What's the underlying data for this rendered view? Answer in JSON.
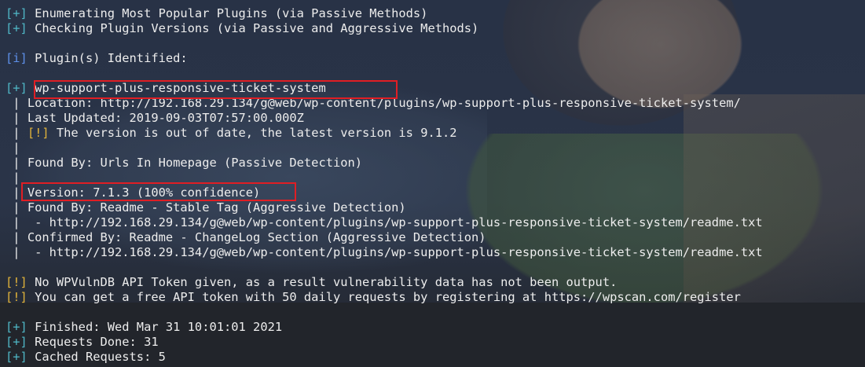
{
  "terminal": {
    "lines": {
      "enum_plugins": {
        "prefix": "[+]",
        "text": " Enumerating Most Popular Plugins (via Passive Methods)"
      },
      "check_versions": {
        "prefix": "[+]",
        "text": " Checking Plugin Versions (via Passive and Aggressive Methods)"
      },
      "identified": {
        "prefix": "[i]",
        "text": " Plugin(s) Identified:"
      },
      "plugin_name": {
        "prefix": "[+]",
        "text": " wp-support-plus-responsive-ticket-system"
      },
      "location": {
        "pipe": " | ",
        "text": "Location: http://192.168.29.134/g@web/wp-content/plugins/wp-support-plus-responsive-ticket-system/"
      },
      "last_updated": {
        "pipe": " | ",
        "text": "Last Updated: 2019-09-03T07:57:00.000Z"
      },
      "out_of_date": {
        "pipe": " | ",
        "prefix": "[!]",
        "text": " The version is out of date, the latest version is 9.1.2"
      },
      "pipe_1": {
        "pipe": " |"
      },
      "found_by_urls": {
        "pipe": " | ",
        "text": "Found By: Urls In Homepage (Passive Detection)"
      },
      "pipe_2": {
        "pipe": " |"
      },
      "version": {
        "pipe": " | ",
        "text": "Version: 7.1.3 (100% confidence)"
      },
      "found_by_readme": {
        "pipe": " | ",
        "text": "Found By: Readme - Stable Tag (Aggressive Detection)"
      },
      "readme_url_1": {
        "pipe": " | ",
        "text": " - http://192.168.29.134/g@web/wp-content/plugins/wp-support-plus-responsive-ticket-system/readme.txt"
      },
      "confirmed_by": {
        "pipe": " | ",
        "text": "Confirmed By: Readme - ChangeLog Section (Aggressive Detection)"
      },
      "readme_url_2": {
        "pipe": " | ",
        "text": " - http://192.168.29.134/g@web/wp-content/plugins/wp-support-plus-responsive-ticket-system/readme.txt"
      },
      "no_token": {
        "prefix": "[!]",
        "text": " No WPVulnDB API Token given, as a result vulnerability data has not been output."
      },
      "free_token": {
        "prefix": "[!]",
        "text": " You can get a free API token with 50 daily requests by registering at https://wpscan.com/register"
      },
      "finished": {
        "prefix": "[+]",
        "text": " Finished: Wed Mar 31 10:01:01 2021"
      },
      "requests_done": {
        "prefix": "[+]",
        "text": " Requests Done: 31"
      },
      "cached_requests": {
        "prefix": "[+]",
        "text": " Cached Requests: 5"
      }
    }
  },
  "colors": {
    "plus": "#4fb6c5",
    "info": "#5d8fe8",
    "warn": "#e0b23a",
    "text": "#ededed",
    "highlight_box": "#e01e24"
  }
}
